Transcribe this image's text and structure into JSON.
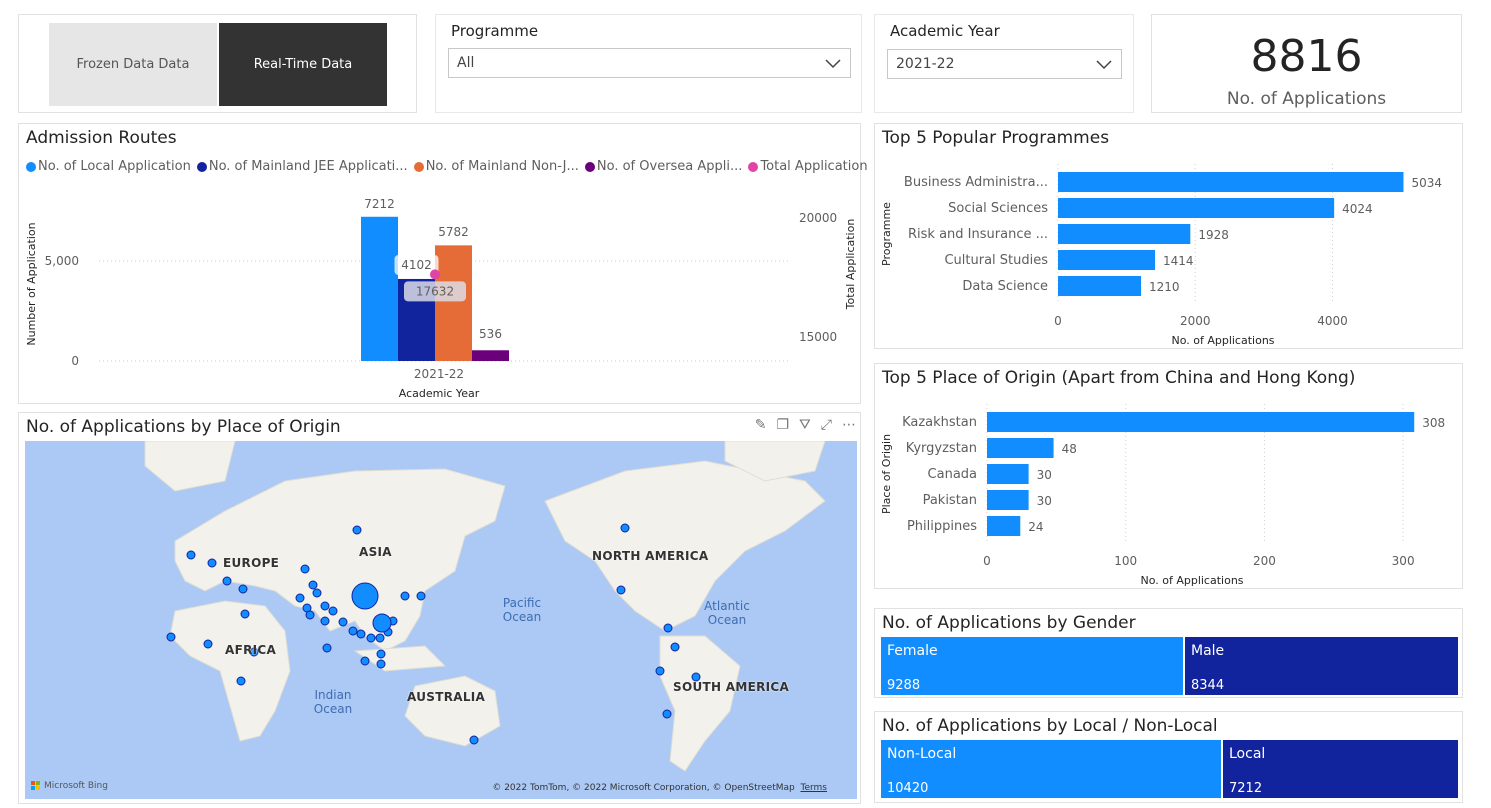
{
  "toggle": {
    "frozen_label": "Frozen Data Data",
    "realtime_label": "Real-Time Data"
  },
  "programme_slicer": {
    "label": "Programme",
    "value": "All"
  },
  "year_slicer": {
    "label": "Academic Year",
    "value": "2021-22"
  },
  "kpi": {
    "value": "8816",
    "label": "No. of Applications"
  },
  "admission_routes": {
    "title": "Admission Routes",
    "legend": [
      {
        "label": "No. of Local Application",
        "color": "#118dff"
      },
      {
        "label": "No. of Mainland JEE Applicati...",
        "color": "#12239e"
      },
      {
        "label": "No. of Mainland Non-J...",
        "color": "#e66c37"
      },
      {
        "label": "No. of Oversea Appli...",
        "color": "#6b007b"
      },
      {
        "label": "Total Application",
        "color": "#e044a7"
      }
    ]
  },
  "top_programmes": {
    "title": "Top 5 Popular Programmes"
  },
  "top_origins": {
    "title": "Top 5 Place of Origin (Apart from China and Hong Kong)"
  },
  "map": {
    "title": "No. of Applications by Place of Origin",
    "continents": [
      "EUROPE",
      "ASIA",
      "NORTH AMERICA",
      "AFRICA",
      "SOUTH AMERICA",
      "AUSTRALIA"
    ],
    "oceans": [
      "Pacific Ocean",
      "Atlantic Ocean",
      "Indian Ocean"
    ],
    "bing": "Microsoft Bing",
    "copyright": "© 2022 TomTom, © 2022 Microsoft Corporation, © OpenStreetMap",
    "terms": "Terms"
  },
  "gender": {
    "title": "No. of Applications by Gender",
    "items": [
      {
        "label": "Female",
        "value": "9288"
      },
      {
        "label": "Male",
        "value": "8344"
      }
    ]
  },
  "locality": {
    "title": "No. of Applications by Local / Non-Local",
    "items": [
      {
        "label": "Non-Local",
        "value": "10420"
      },
      {
        "label": "Local",
        "value": "7212"
      }
    ]
  },
  "chart_data": [
    {
      "type": "bar",
      "title": "Admission Routes",
      "xlabel": "Academic Year",
      "ylabel": "Number of Application",
      "y2label": "Total Application",
      "categories": [
        "2021-22"
      ],
      "ylim": [
        0,
        7600
      ],
      "y_ticks": [
        "0",
        "5,000"
      ],
      "y2_ticks": [
        "15000",
        "20000"
      ],
      "series": [
        {
          "name": "No. of Local Application",
          "values": [
            7212
          ],
          "color": "#118dff"
        },
        {
          "name": "No. of Mainland JEE Applicati...",
          "values": [
            4102
          ],
          "color": "#12239e"
        },
        {
          "name": "No. of Mainland Non-J...",
          "values": [
            5782
          ],
          "color": "#e66c37"
        },
        {
          "name": "No. of Oversea Appli...",
          "values": [
            536
          ],
          "color": "#6b007b"
        },
        {
          "name": "Total Application",
          "values": [
            17632
          ],
          "color": "#e044a7",
          "axis": "secondary",
          "render": "point"
        }
      ]
    },
    {
      "type": "bar",
      "orientation": "horizontal",
      "title": "Top 5 Popular Programmes",
      "xlabel": "No. of Applications",
      "ylabel": "Programme",
      "categories": [
        "Business Administra...",
        "Social Sciences",
        "Risk and Insurance ...",
        "Cultural Studies",
        "Data Science"
      ],
      "values": [
        5034,
        4024,
        1928,
        1414,
        1210
      ],
      "xlim": [
        0,
        5100
      ],
      "x_ticks": [
        0,
        2000,
        4000
      ],
      "color": "#118dff"
    },
    {
      "type": "bar",
      "orientation": "horizontal",
      "title": "Top 5 Place of Origin (Apart from China and Hong Kong)",
      "xlabel": "No. of Applications",
      "ylabel": "Place of Origin",
      "categories": [
        "Kazakhstan",
        "Kyrgyzstan",
        "Canada",
        "Pakistan",
        "Philippines"
      ],
      "values": [
        308,
        48,
        30,
        30,
        24
      ],
      "xlim": [
        0,
        310
      ],
      "x_ticks": [
        0,
        100,
        200,
        300
      ],
      "color": "#118dff"
    }
  ]
}
